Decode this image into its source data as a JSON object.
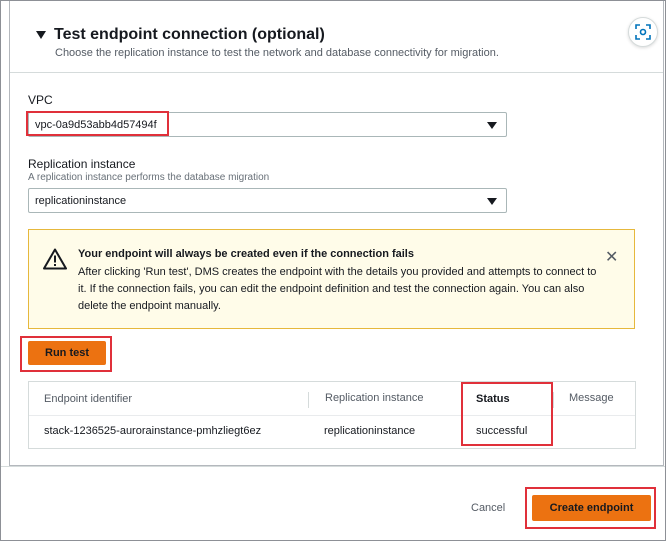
{
  "section": {
    "title": "Test endpoint connection (optional)",
    "subtitle": "Choose the replication instance to test the network and database connectivity for migration."
  },
  "vpc": {
    "label": "VPC",
    "value": "vpc-0a9d53abb4d57494f"
  },
  "replication_instance": {
    "label": "Replication instance",
    "description": "A replication instance performs the database migration",
    "value": "replicationinstance"
  },
  "alert": {
    "title": "Your endpoint will always be created even if the connection fails",
    "body": "After clicking 'Run test', DMS creates the endpoint with the details you provided and attempts to connect to it. If the connection fails, you can edit the endpoint definition and test the connection again. You can also delete the endpoint manually.",
    "close_glyph": "✕"
  },
  "run_test_label": "Run test",
  "table": {
    "headers": [
      "Endpoint identifier",
      "Replication instance",
      "Status",
      "Message"
    ],
    "rows": [
      {
        "endpoint": "stack-1236525-aurorainstance-pmhzliegt6ez",
        "instance": "replicationinstance",
        "status": "successful",
        "message": ""
      }
    ]
  },
  "footer": {
    "cancel_label": "Cancel",
    "create_label": "Create endpoint"
  },
  "colors": {
    "accent": "#ec7211",
    "highlight": "#e0303a",
    "alert_bg": "#fffce9",
    "alert_border": "#e6b83c"
  },
  "icons": {
    "collapse": "caret-down-icon",
    "focus": "focus-icon",
    "warning": "warning-icon",
    "close": "close-icon",
    "select": "chevron-down-icon"
  }
}
